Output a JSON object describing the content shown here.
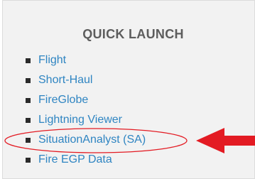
{
  "quick_launch": {
    "title": "QUICK LAUNCH",
    "items": [
      {
        "label": "Flight"
      },
      {
        "label": "Short-Haul"
      },
      {
        "label": "FireGlobe"
      },
      {
        "label": "Lightning Viewer"
      },
      {
        "label": "SituationAnalyst (SA)"
      },
      {
        "label": "Fire EGP Data"
      }
    ]
  },
  "colors": {
    "panel_background": "#f2f2f2",
    "link": "#2f85c2",
    "title": "#5d5d5d",
    "annotation_red": "#e31b23"
  }
}
